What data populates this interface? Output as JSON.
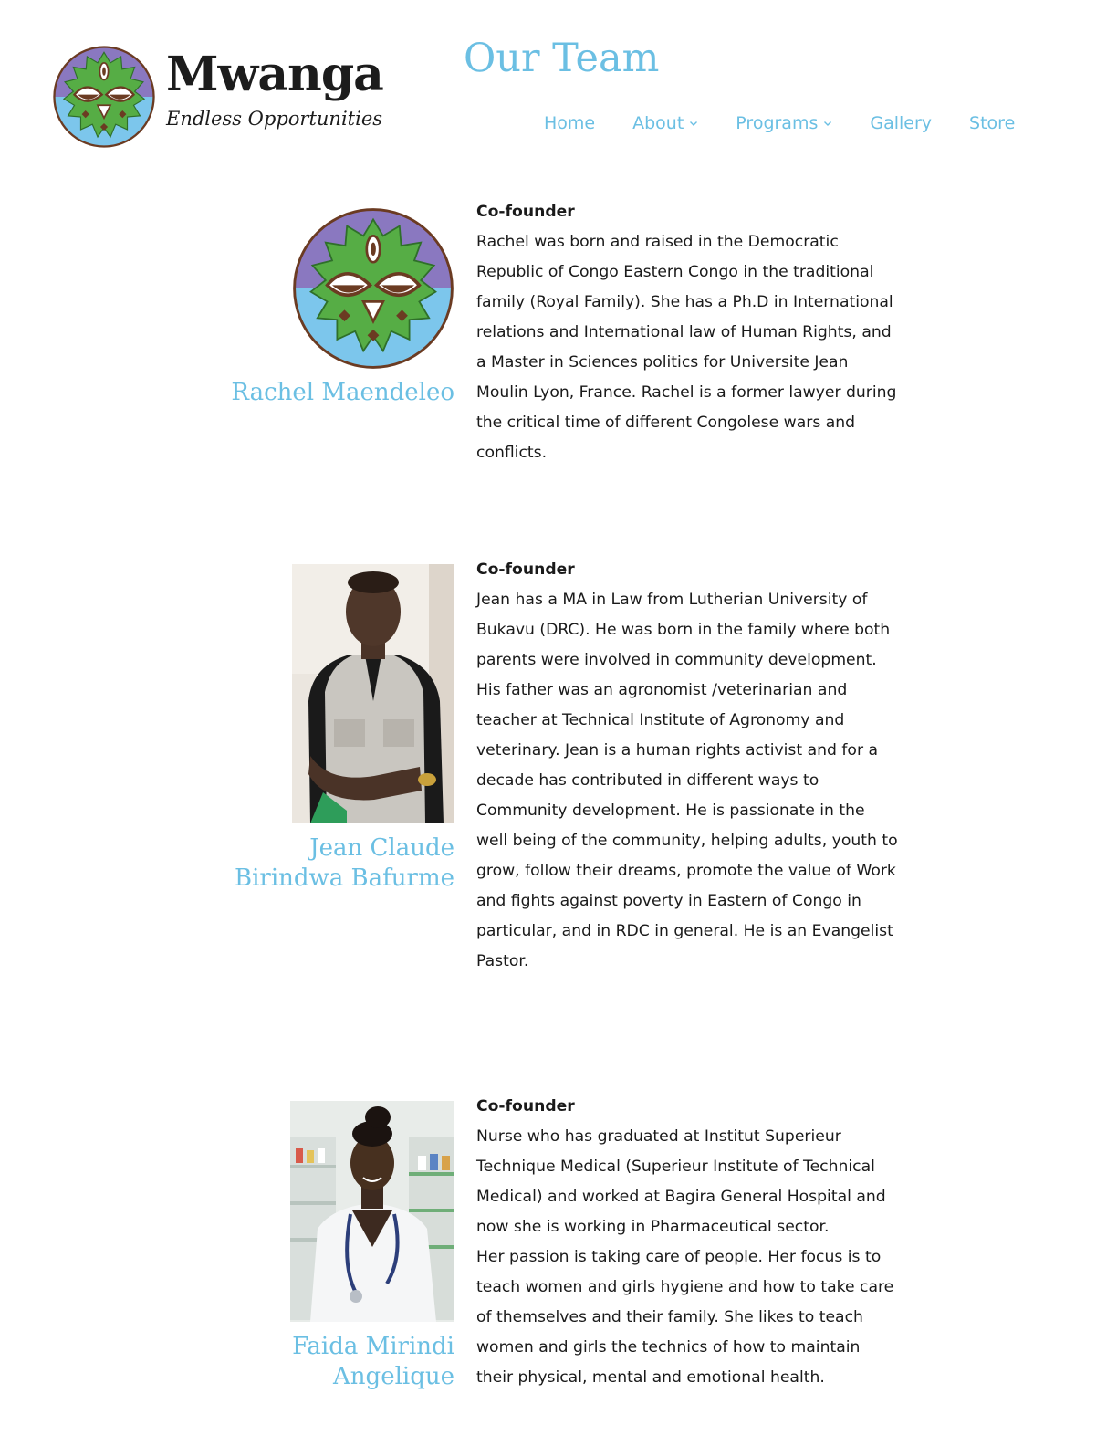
{
  "brand": {
    "name": "Mwanga",
    "tagline": "Endless Opportunities",
    "colors": {
      "accent": "#6bbfe3",
      "logo_purple": "#8a78c0",
      "logo_blue": "#7cc6ec",
      "logo_green": "#56ad45",
      "logo_brown": "#6b3b22"
    }
  },
  "header": {
    "page_title": "Our Team"
  },
  "nav": {
    "items": [
      {
        "label": "Home",
        "has_dropdown": false
      },
      {
        "label": "About",
        "has_dropdown": true
      },
      {
        "label": "Programs",
        "has_dropdown": true
      },
      {
        "label": "Gallery",
        "has_dropdown": false
      },
      {
        "label": "Store",
        "has_dropdown": false
      }
    ]
  },
  "team": [
    {
      "name_lines": [
        "Rachel Maendeleo"
      ],
      "role": "Co-founder",
      "photo": "logo-placeholder",
      "bio": [
        "Rachel was born and raised in the Democratic Republic of Congo Eastern Congo in the traditional family (Royal Family). She has a Ph.D in International relations and International law of Human Rights, and a Master in Sciences politics for Universite Jean Moulin Lyon, France. Rachel is a former lawyer during the critical time of different Congolese wars and conflicts."
      ]
    },
    {
      "name_lines": [
        "Jean Claude",
        "Birindwa Bafurme"
      ],
      "role": "Co-founder",
      "photo": "portrait-man-grey-vest",
      "bio": [
        "Jean has a MA in Law from Lutherian University of Bukavu (DRC). He was born in the family where both parents were involved in community development. His father was an agronomist /veterinarian and teacher at Technical Institute of Agronomy and veterinary. Jean is a human rights activist and for a decade has contributed in different ways to Community development. He is passionate in the well being of the community, helping adults, youth to grow, follow their dreams, promote the value of Work and fights against poverty in Eastern of Congo in particular, and in RDC in general. He is an Evangelist Pastor."
      ]
    },
    {
      "name_lines": [
        "Faida Mirindi",
        "Angelique"
      ],
      "role": "Co-founder",
      "photo": "portrait-woman-white-coat",
      "bio": [
        "Nurse who has graduated at Institut Superieur Technique Medical (Superieur Institute of Technical Medical) and worked at Bagira General Hospital and now she is working in Pharmaceutical sector.",
        "Her passion is taking care of people. Her focus is to teach women and girls hygiene and how to take care of themselves and their family. She likes to teach women and girls the technics of how to maintain their physical, mental and emotional health."
      ]
    }
  ]
}
